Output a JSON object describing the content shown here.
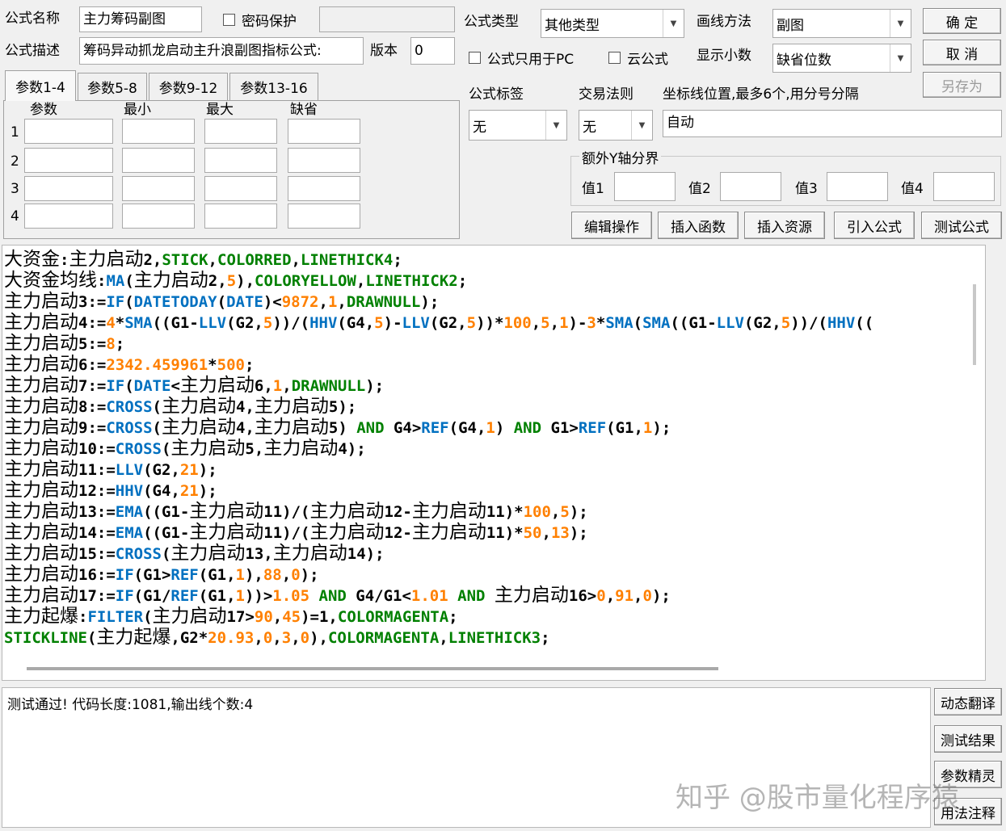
{
  "top": {
    "formula_name_label": "公式名称",
    "formula_name_value": "主力筹码副图",
    "password_label": "密码保护",
    "formula_desc_label": "公式描述",
    "formula_desc_value": "筹码异动抓龙启动主升浪副图指标公式:",
    "version_label": "版本",
    "version_value": "0",
    "formula_type_label": "公式类型",
    "formula_type_value": "其他类型",
    "draw_method_label": "画线方法",
    "draw_method_value": "副图",
    "pc_only_label": "公式只用于PC",
    "cloud_label": "云公式",
    "decimals_label": "显示小数",
    "decimals_value": "缺省位数",
    "ok_button": "确 定",
    "cancel_button": "取 消",
    "save_as_button": "另存为"
  },
  "params": {
    "tabs": [
      "参数1-4",
      "参数5-8",
      "参数9-12",
      "参数13-16"
    ],
    "headers": [
      "参数",
      "最小",
      "最大",
      "缺省"
    ],
    "rows": [
      "1",
      "2",
      "3",
      "4"
    ]
  },
  "right": {
    "tag_label": "公式标签",
    "tag_value": "无",
    "trade_rule_label": "交易法则",
    "trade_rule_value": "无",
    "coord_label": "坐标线位置,最多6个,用分号分隔",
    "coord_value": "自动",
    "yaxis_title": "额外Y轴分界",
    "value_labels": [
      "值1",
      "值2",
      "值3",
      "值4"
    ]
  },
  "actions": [
    "编辑操作",
    "插入函数",
    "插入资源",
    "引入公式",
    "测试公式"
  ],
  "side_buttons": [
    "动态翻译",
    "测试结果",
    "参数精灵",
    "用法注释"
  ],
  "output_text": "测试通过! 代码长度:1081,输出线个数:4",
  "watermark": "知乎 @股市量化程序猿",
  "code_lines": [
    [
      [
        "t",
        "大资金"
      ],
      [
        "k",
        ":"
      ],
      [
        "t",
        "主力启动"
      ],
      [
        "k",
        "2,"
      ],
      [
        "g",
        "STICK"
      ],
      [
        "k",
        ","
      ],
      [
        "g",
        "COLORRED"
      ],
      [
        "k",
        ","
      ],
      [
        "g",
        "LINETHICK4"
      ],
      [
        "k",
        ";"
      ]
    ],
    [
      [
        "t",
        "大资金均线"
      ],
      [
        "k",
        ":"
      ],
      [
        "b",
        "MA"
      ],
      [
        "k",
        "("
      ],
      [
        "t",
        "主力启动"
      ],
      [
        "k",
        "2,"
      ],
      [
        "o",
        "5"
      ],
      [
        "k",
        "),"
      ],
      [
        "g",
        "COLORYELLOW"
      ],
      [
        "k",
        ","
      ],
      [
        "g",
        "LINETHICK2"
      ],
      [
        "k",
        ";"
      ]
    ],
    [
      [
        "t",
        "主力启动"
      ],
      [
        "k",
        "3:="
      ],
      [
        "b",
        "IF"
      ],
      [
        "k",
        "("
      ],
      [
        "b",
        "DATETODAY"
      ],
      [
        "k",
        "("
      ],
      [
        "b",
        "DATE"
      ],
      [
        "k",
        ")<"
      ],
      [
        "o",
        "9872"
      ],
      [
        "k",
        ","
      ],
      [
        "o",
        "1"
      ],
      [
        "k",
        ","
      ],
      [
        "g",
        "DRAWNULL"
      ],
      [
        "k",
        ");"
      ]
    ],
    [
      [
        "t",
        "主力启动"
      ],
      [
        "k",
        "4:="
      ],
      [
        "o",
        "4"
      ],
      [
        "k",
        "*"
      ],
      [
        "b",
        "SMA"
      ],
      [
        "k",
        "((G1-"
      ],
      [
        "b",
        "LLV"
      ],
      [
        "k",
        "(G2,"
      ],
      [
        "o",
        "5"
      ],
      [
        "k",
        "))/("
      ],
      [
        "b",
        "HHV"
      ],
      [
        "k",
        "(G4,"
      ],
      [
        "o",
        "5"
      ],
      [
        "k",
        ")-"
      ],
      [
        "b",
        "LLV"
      ],
      [
        "k",
        "(G2,"
      ],
      [
        "o",
        "5"
      ],
      [
        "k",
        "))*"
      ],
      [
        "o",
        "100"
      ],
      [
        "k",
        ","
      ],
      [
        "o",
        "5"
      ],
      [
        "k",
        ","
      ],
      [
        "o",
        "1"
      ],
      [
        "k",
        ")-"
      ],
      [
        "o",
        "3"
      ],
      [
        "k",
        "*"
      ],
      [
        "b",
        "SMA"
      ],
      [
        "k",
        "("
      ],
      [
        "b",
        "SMA"
      ],
      [
        "k",
        "((G1-"
      ],
      [
        "b",
        "LLV"
      ],
      [
        "k",
        "(G2,"
      ],
      [
        "o",
        "5"
      ],
      [
        "k",
        "))/("
      ],
      [
        "b",
        "HHV"
      ],
      [
        "k",
        "(("
      ]
    ],
    [
      [
        "t",
        "主力启动"
      ],
      [
        "k",
        "5:="
      ],
      [
        "o",
        "8"
      ],
      [
        "k",
        ";"
      ]
    ],
    [
      [
        "t",
        "主力启动"
      ],
      [
        "k",
        "6:="
      ],
      [
        "o",
        "2342.459961"
      ],
      [
        "k",
        "*"
      ],
      [
        "o",
        "500"
      ],
      [
        "k",
        ";"
      ]
    ],
    [
      [
        "t",
        "主力启动"
      ],
      [
        "k",
        "7:="
      ],
      [
        "b",
        "IF"
      ],
      [
        "k",
        "("
      ],
      [
        "b",
        "DATE"
      ],
      [
        "k",
        "<"
      ],
      [
        "t",
        "主力启动"
      ],
      [
        "k",
        "6,"
      ],
      [
        "o",
        "1"
      ],
      [
        "k",
        ","
      ],
      [
        "g",
        "DRAWNULL"
      ],
      [
        "k",
        ");"
      ]
    ],
    [
      [
        "t",
        "主力启动"
      ],
      [
        "k",
        "8:="
      ],
      [
        "b",
        "CROSS"
      ],
      [
        "k",
        "("
      ],
      [
        "t",
        "主力启动"
      ],
      [
        "k",
        "4,"
      ],
      [
        "t",
        "主力启动"
      ],
      [
        "k",
        "5);"
      ]
    ],
    [
      [
        "t",
        "主力启动"
      ],
      [
        "k",
        "9:="
      ],
      [
        "b",
        "CROSS"
      ],
      [
        "k",
        "("
      ],
      [
        "t",
        "主力启动"
      ],
      [
        "k",
        "4,"
      ],
      [
        "t",
        "主力启动"
      ],
      [
        "k",
        "5) "
      ],
      [
        "g",
        "AND"
      ],
      [
        "k",
        " G4>"
      ],
      [
        "b",
        "REF"
      ],
      [
        "k",
        "(G4,"
      ],
      [
        "o",
        "1"
      ],
      [
        "k",
        ") "
      ],
      [
        "g",
        "AND"
      ],
      [
        "k",
        " G1>"
      ],
      [
        "b",
        "REF"
      ],
      [
        "k",
        "(G1,"
      ],
      [
        "o",
        "1"
      ],
      [
        "k",
        ");"
      ]
    ],
    [
      [
        "t",
        "主力启动"
      ],
      [
        "k",
        "10:="
      ],
      [
        "b",
        "CROSS"
      ],
      [
        "k",
        "("
      ],
      [
        "t",
        "主力启动"
      ],
      [
        "k",
        "5,"
      ],
      [
        "t",
        "主力启动"
      ],
      [
        "k",
        "4);"
      ]
    ],
    [
      [
        "t",
        "主力启动"
      ],
      [
        "k",
        "11:="
      ],
      [
        "b",
        "LLV"
      ],
      [
        "k",
        "(G2,"
      ],
      [
        "o",
        "21"
      ],
      [
        "k",
        ");"
      ]
    ],
    [
      [
        "t",
        "主力启动"
      ],
      [
        "k",
        "12:="
      ],
      [
        "b",
        "HHV"
      ],
      [
        "k",
        "(G4,"
      ],
      [
        "o",
        "21"
      ],
      [
        "k",
        ");"
      ]
    ],
    [
      [
        "t",
        "主力启动"
      ],
      [
        "k",
        "13:="
      ],
      [
        "b",
        "EMA"
      ],
      [
        "k",
        "((G1-"
      ],
      [
        "t",
        "主力启动"
      ],
      [
        "k",
        "11)/("
      ],
      [
        "t",
        "主力启动"
      ],
      [
        "k",
        "12-"
      ],
      [
        "t",
        "主力启动"
      ],
      [
        "k",
        "11)*"
      ],
      [
        "o",
        "100"
      ],
      [
        "k",
        ","
      ],
      [
        "o",
        "5"
      ],
      [
        "k",
        ");"
      ]
    ],
    [
      [
        "t",
        "主力启动"
      ],
      [
        "k",
        "14:="
      ],
      [
        "b",
        "EMA"
      ],
      [
        "k",
        "((G1-"
      ],
      [
        "t",
        "主力启动"
      ],
      [
        "k",
        "11)/("
      ],
      [
        "t",
        "主力启动"
      ],
      [
        "k",
        "12-"
      ],
      [
        "t",
        "主力启动"
      ],
      [
        "k",
        "11)*"
      ],
      [
        "o",
        "50"
      ],
      [
        "k",
        ","
      ],
      [
        "o",
        "13"
      ],
      [
        "k",
        ");"
      ]
    ],
    [
      [
        "t",
        "主力启动"
      ],
      [
        "k",
        "15:="
      ],
      [
        "b",
        "CROSS"
      ],
      [
        "k",
        "("
      ],
      [
        "t",
        "主力启动"
      ],
      [
        "k",
        "13,"
      ],
      [
        "t",
        "主力启动"
      ],
      [
        "k",
        "14);"
      ]
    ],
    [
      [
        "t",
        "主力启动"
      ],
      [
        "k",
        "16:="
      ],
      [
        "b",
        "IF"
      ],
      [
        "k",
        "(G1>"
      ],
      [
        "b",
        "REF"
      ],
      [
        "k",
        "(G1,"
      ],
      [
        "o",
        "1"
      ],
      [
        "k",
        "),"
      ],
      [
        "o",
        "88"
      ],
      [
        "k",
        ","
      ],
      [
        "o",
        "0"
      ],
      [
        "k",
        ");"
      ]
    ],
    [
      [
        "t",
        "主力启动"
      ],
      [
        "k",
        "17:="
      ],
      [
        "b",
        "IF"
      ],
      [
        "k",
        "(G1/"
      ],
      [
        "b",
        "REF"
      ],
      [
        "k",
        "(G1,"
      ],
      [
        "o",
        "1"
      ],
      [
        "k",
        "))>"
      ],
      [
        "o",
        "1.05"
      ],
      [
        "k",
        " "
      ],
      [
        "g",
        "AND"
      ],
      [
        "k",
        " G4/G1<"
      ],
      [
        "o",
        "1.01"
      ],
      [
        "k",
        " "
      ],
      [
        "g",
        "AND"
      ],
      [
        "k",
        " "
      ],
      [
        "t",
        "主力启动"
      ],
      [
        "k",
        "16>"
      ],
      [
        "o",
        "0"
      ],
      [
        "k",
        ","
      ],
      [
        "o",
        "91"
      ],
      [
        "k",
        ","
      ],
      [
        "o",
        "0"
      ],
      [
        "k",
        ");"
      ]
    ],
    [
      [
        "t",
        "主力起爆"
      ],
      [
        "k",
        ":"
      ],
      [
        "b",
        "FILTER"
      ],
      [
        "k",
        "("
      ],
      [
        "t",
        "主力启动"
      ],
      [
        "k",
        "17>"
      ],
      [
        "o",
        "90"
      ],
      [
        "k",
        ","
      ],
      [
        "o",
        "45"
      ],
      [
        "k",
        ")=1,"
      ],
      [
        "g",
        "COLORMAGENTA"
      ],
      [
        "k",
        ";"
      ]
    ],
    [
      [
        "g",
        "STICKLINE"
      ],
      [
        "k",
        "("
      ],
      [
        "t",
        "主力起爆"
      ],
      [
        "k",
        ",G2*"
      ],
      [
        "o",
        "20.93"
      ],
      [
        "k",
        ","
      ],
      [
        "o",
        "0"
      ],
      [
        "k",
        ","
      ],
      [
        "o",
        "3"
      ],
      [
        "k",
        ","
      ],
      [
        "o",
        "0"
      ],
      [
        "k",
        "),"
      ],
      [
        "g",
        "COLORMAGENTA"
      ],
      [
        "k",
        ","
      ],
      [
        "g",
        "LINETHICK3"
      ],
      [
        "k",
        ";"
      ]
    ]
  ]
}
